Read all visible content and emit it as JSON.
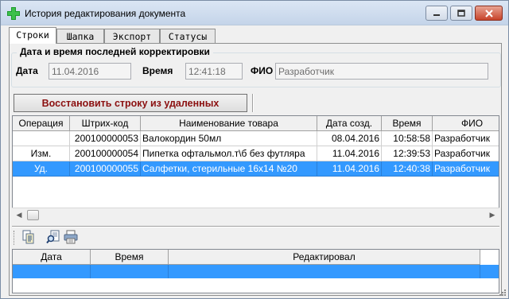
{
  "window": {
    "title": "История редактирования документа",
    "icon": "green-plus-pharmacy-icon"
  },
  "tabs": [
    {
      "label": "Строки",
      "active": true
    },
    {
      "label": "Шапка",
      "active": false
    },
    {
      "label": "Экспорт",
      "active": false
    },
    {
      "label": "Статусы",
      "active": false
    }
  ],
  "last_edit": {
    "group_title": "Дата и время последней корректировки",
    "date_label": "Дата",
    "date_value": "11.04.2016",
    "time_label": "Время",
    "time_value": "12:41:18",
    "user_label": "ФИО",
    "user_value": "Разработчик"
  },
  "restore_button": {
    "label": "Восстановить строку из удаленных"
  },
  "rows_grid": {
    "columns": [
      "Операция",
      "Штрих-код",
      "Наименование товара",
      "Дата созд.",
      "Время",
      "ФИО"
    ],
    "rows": [
      {
        "op": "",
        "barcode": "200100000053",
        "name": "Валокордин 50мл",
        "date": "08.04.2016",
        "time": "10:58:58",
        "user": "Разработчик",
        "selected": false
      },
      {
        "op": "Изм.",
        "barcode": "200100000054",
        "name": "Пипетка офтальмол.т\\б без футляра",
        "date": "11.04.2016",
        "time": "12:39:53",
        "user": "Разработчик",
        "selected": false
      },
      {
        "op": "Уд.",
        "barcode": "200100000055",
        "name": "Салфетки, стерильные 16х14 №20",
        "date": "11.04.2016",
        "time": "12:40:38",
        "user": "Разработчик",
        "selected": true
      }
    ]
  },
  "detail_toolbar": {
    "tools": [
      "copy-document-icon",
      "find-document-icon",
      "printer-icon"
    ]
  },
  "history_grid": {
    "columns": [
      "Дата",
      "Время",
      "Редактировал"
    ],
    "rows": [
      {
        "date": "",
        "time": "",
        "editor": "",
        "selected": true
      }
    ]
  },
  "colors": {
    "selection": "#3399ff",
    "restore_text": "#8b1010",
    "window_border": "#7a8da5"
  }
}
